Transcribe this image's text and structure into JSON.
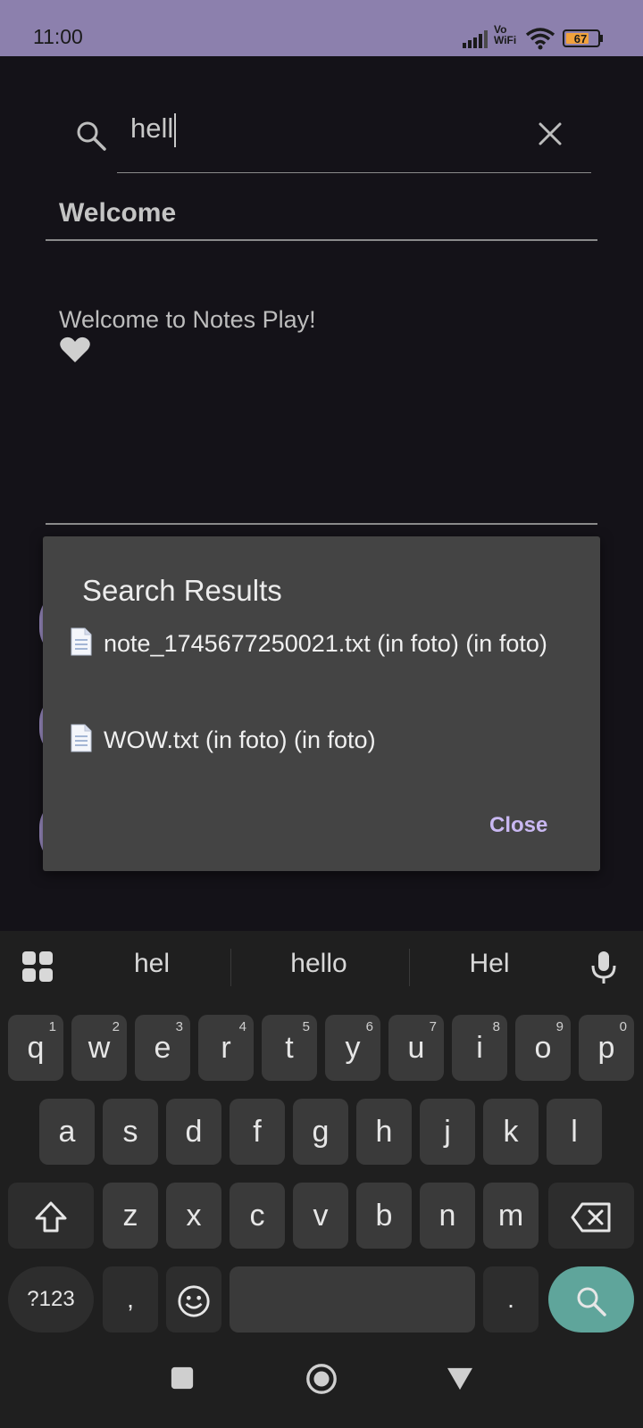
{
  "status_bar": {
    "time": "11:00",
    "network_label_top": "Vo",
    "network_label_bottom": "WiFi",
    "battery_level": "67"
  },
  "search": {
    "query": "hell"
  },
  "note": {
    "title": "Welcome",
    "body": "Welcome to Notes Play!",
    "heart_color": "#cfcfcf"
  },
  "dialog": {
    "title": "Search Results",
    "results": [
      "note_1745677250021.txt (in foto) (in foto)",
      "WOW.txt (in foto) (in foto)"
    ],
    "close_label": "Close"
  },
  "keyboard": {
    "suggestions": [
      "hel",
      "hello",
      "Hel"
    ],
    "row1": [
      {
        "key": "q",
        "num": "1"
      },
      {
        "key": "w",
        "num": "2"
      },
      {
        "key": "e",
        "num": "3"
      },
      {
        "key": "r",
        "num": "4"
      },
      {
        "key": "t",
        "num": "5"
      },
      {
        "key": "y",
        "num": "6"
      },
      {
        "key": "u",
        "num": "7"
      },
      {
        "key": "i",
        "num": "8"
      },
      {
        "key": "o",
        "num": "9"
      },
      {
        "key": "p",
        "num": "0"
      }
    ],
    "row2": [
      "a",
      "s",
      "d",
      "f",
      "g",
      "h",
      "j",
      "k",
      "l"
    ],
    "row3": [
      "z",
      "x",
      "c",
      "v",
      "b",
      "n",
      "m"
    ],
    "symbols_label": "?123",
    "comma": ",",
    "period": ".",
    "accent_color": "#5fa59b"
  }
}
